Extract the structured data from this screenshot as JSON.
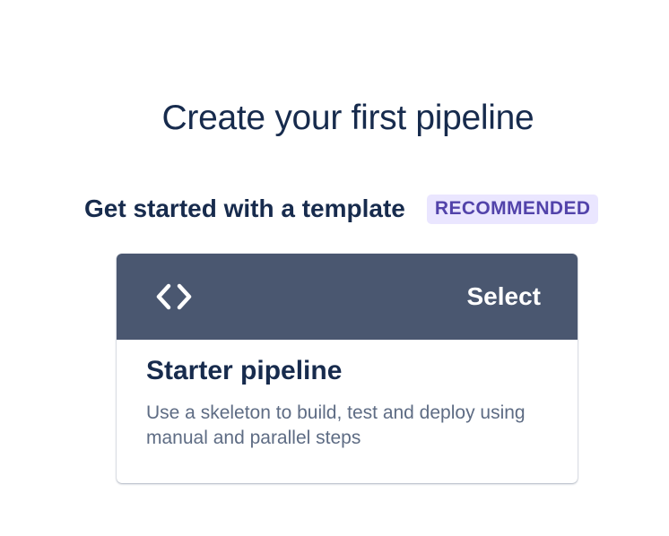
{
  "page": {
    "title": "Create your first pipeline"
  },
  "template_section": {
    "heading": "Get started with a template",
    "badge": "RECOMMENDED"
  },
  "card": {
    "icon": "code-icon",
    "select_label": "Select",
    "title": "Starter pipeline",
    "description": "Use a skeleton to build, test and deploy using manual and parallel steps"
  },
  "colors": {
    "text_primary": "#172b4d",
    "text_secondary": "#5e6c84",
    "card_header": "#4a5770",
    "badge_bg": "#eae6ff",
    "badge_text": "#5243aa"
  }
}
